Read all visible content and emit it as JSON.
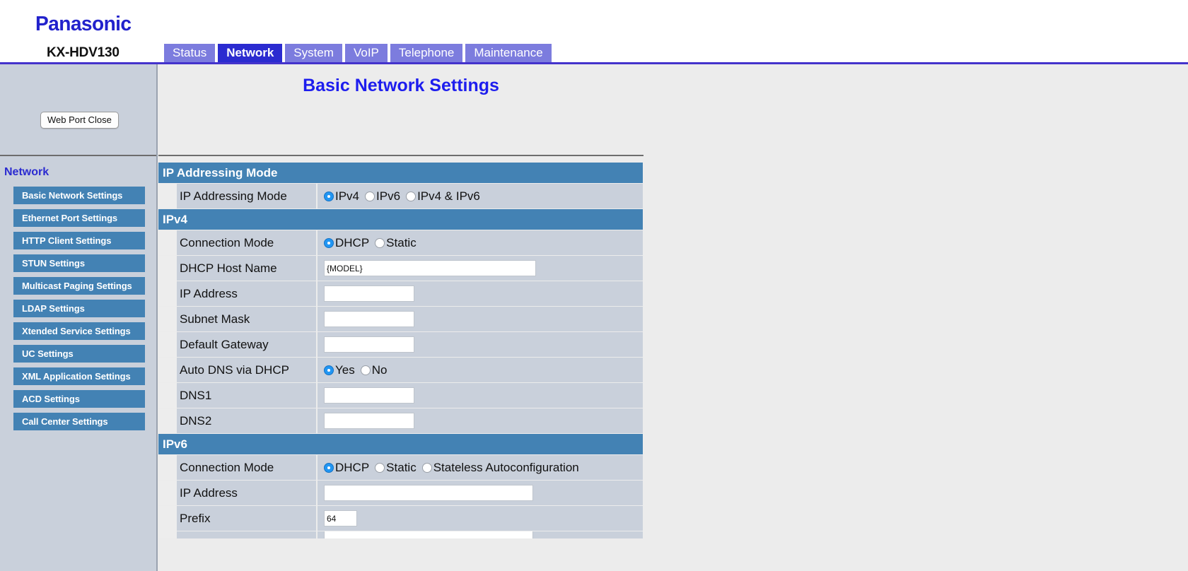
{
  "header": {
    "brand": "Panasonic",
    "model": "KX-HDV130"
  },
  "tabs": [
    {
      "label": "Status",
      "active": false
    },
    {
      "label": "Network",
      "active": true
    },
    {
      "label": "System",
      "active": false
    },
    {
      "label": "VoIP",
      "active": false
    },
    {
      "label": "Telephone",
      "active": false
    },
    {
      "label": "Maintenance",
      "active": false
    }
  ],
  "sidebar": {
    "web_port_close": "Web Port Close",
    "group_title": "Network",
    "items": [
      {
        "label": "Basic Network Settings"
      },
      {
        "label": "Ethernet Port Settings"
      },
      {
        "label": "HTTP Client Settings"
      },
      {
        "label": "STUN Settings"
      },
      {
        "label": "Multicast Paging Settings"
      },
      {
        "label": "LDAP Settings"
      },
      {
        "label": "Xtended Service Settings"
      },
      {
        "label": "UC Settings"
      },
      {
        "label": "XML Application Settings"
      },
      {
        "label": "ACD Settings"
      },
      {
        "label": "Call Center Settings"
      }
    ]
  },
  "main": {
    "page_title": "Basic Network Settings",
    "sections": [
      {
        "heading": "IP Addressing Mode",
        "rows": [
          {
            "label": "IP Addressing Mode",
            "type": "radio",
            "options": [
              {
                "label": "IPv4",
                "checked": true
              },
              {
                "label": "IPv6",
                "checked": false
              },
              {
                "label": "IPv4 & IPv6",
                "checked": false
              }
            ]
          }
        ]
      },
      {
        "heading": "IPv4",
        "rows": [
          {
            "label": "Connection Mode",
            "type": "radio",
            "options": [
              {
                "label": "DHCP",
                "checked": true
              },
              {
                "label": "Static",
                "checked": false
              }
            ]
          },
          {
            "label": "DHCP Host Name",
            "type": "text",
            "value": "{MODEL}",
            "width": "w-xwide"
          },
          {
            "label": "IP Address",
            "type": "text",
            "value": "",
            "width": "w-med"
          },
          {
            "label": "Subnet Mask",
            "type": "text",
            "value": "",
            "width": "w-med"
          },
          {
            "label": "Default Gateway",
            "type": "text",
            "value": "",
            "width": "w-med"
          },
          {
            "label": "Auto DNS via DHCP",
            "type": "radio",
            "options": [
              {
                "label": "Yes",
                "checked": true
              },
              {
                "label": "No",
                "checked": false
              }
            ]
          },
          {
            "label": "DNS1",
            "type": "text",
            "value": "",
            "width": "w-med"
          },
          {
            "label": "DNS2",
            "type": "text",
            "value": "",
            "width": "w-med"
          }
        ]
      },
      {
        "heading": "IPv6",
        "rows": [
          {
            "label": "Connection Mode",
            "type": "radio",
            "options": [
              {
                "label": "DHCP",
                "checked": true
              },
              {
                "label": "Static",
                "checked": false
              },
              {
                "label": "Stateless Autoconfiguration",
                "checked": false
              }
            ]
          },
          {
            "label": "IP Address",
            "type": "text",
            "value": "",
            "width": "w-wide"
          },
          {
            "label": "Prefix",
            "type": "text",
            "value": "64",
            "width": "w-small"
          }
        ]
      }
    ]
  },
  "colors": {
    "section_header_blue": "#4382B4",
    "nav_item_blue": "#4382B4",
    "tab_inactive": "#7C7CDE",
    "tab_active": "#2B2BD0",
    "brand_blue": "#2222CC",
    "title_blue": "#1D1DEE",
    "sidebar_bg": "#C9D0DB",
    "main_bg": "#ECECEC",
    "radio_checked": "#2196F3"
  }
}
